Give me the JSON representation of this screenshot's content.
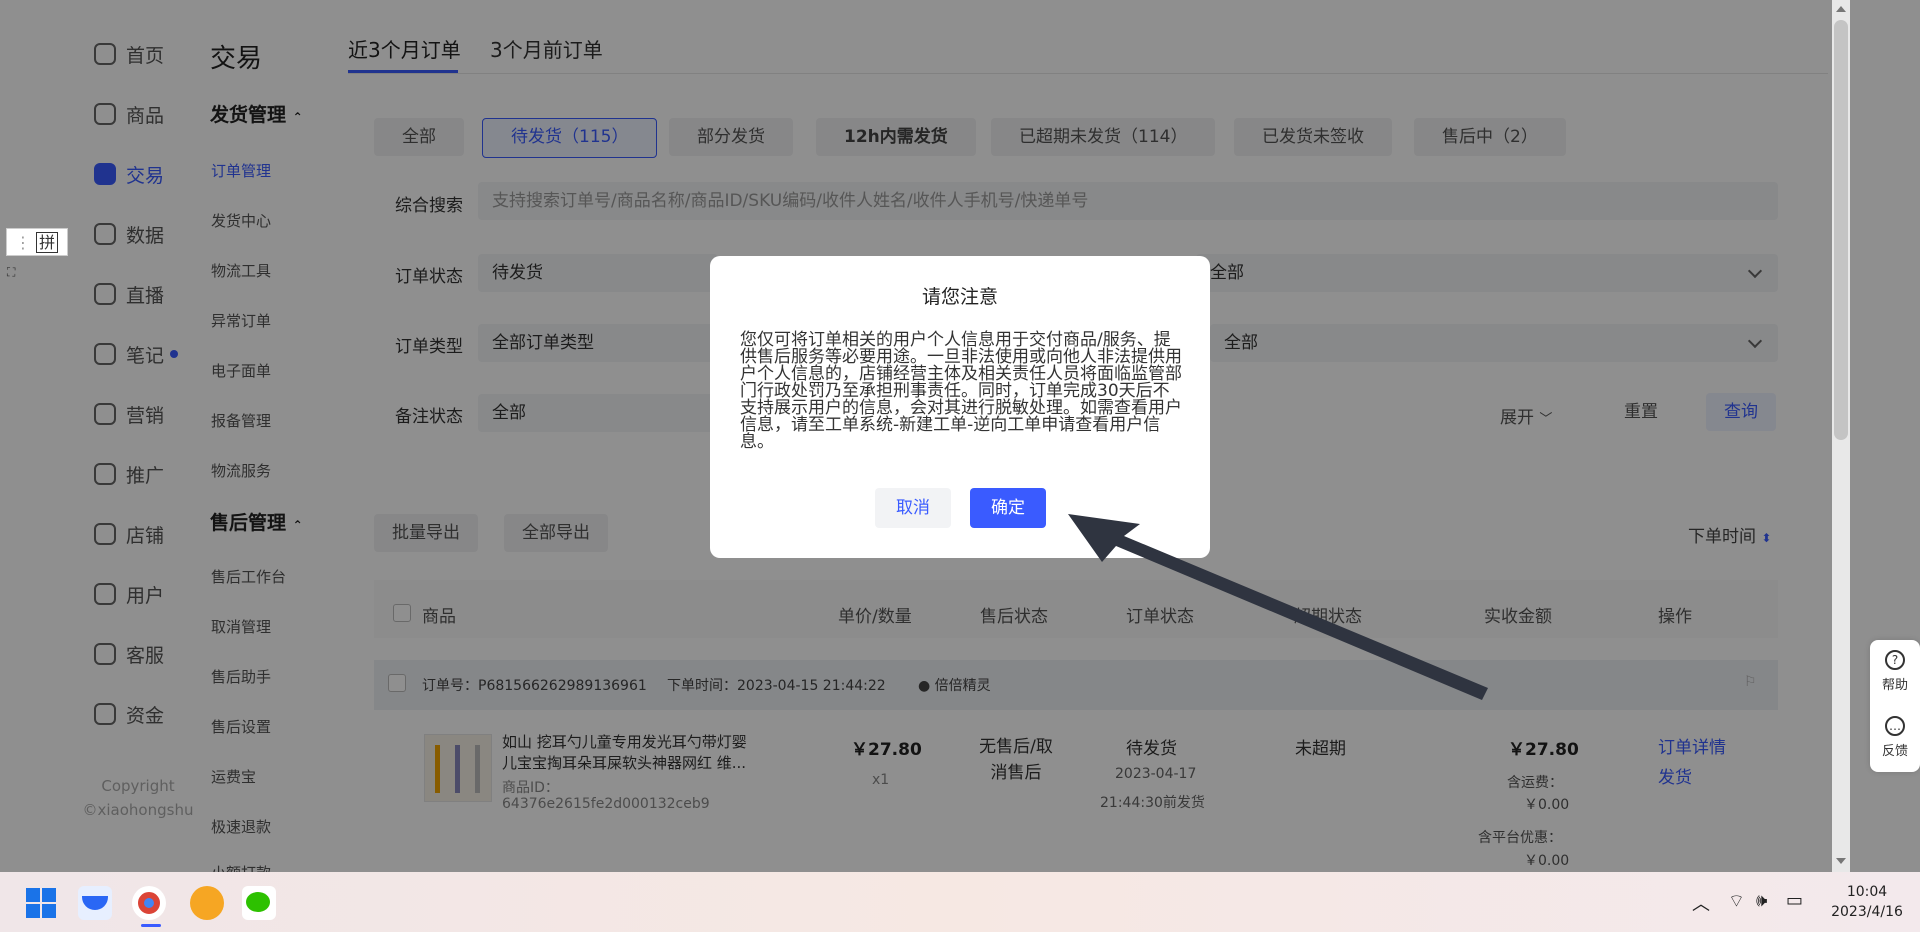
{
  "nav_primary": [
    {
      "label": "首页",
      "icon": "home-icon"
    },
    {
      "label": "商品",
      "icon": "product-icon"
    },
    {
      "label": "交易",
      "icon": "trade-icon"
    },
    {
      "label": "数据",
      "icon": "chart-icon"
    },
    {
      "label": "直播",
      "icon": "live-icon"
    },
    {
      "label": "笔记",
      "icon": "note-icon"
    },
    {
      "label": "营销",
      "icon": "megaphone-icon"
    },
    {
      "label": "推广",
      "icon": "promote-icon"
    },
    {
      "label": "店铺",
      "icon": "store-icon"
    },
    {
      "label": "用户",
      "icon": "users-icon"
    },
    {
      "label": "客服",
      "icon": "service-icon"
    },
    {
      "label": "资金",
      "icon": "wallet-icon"
    }
  ],
  "copyright": [
    "Copyright",
    "©xiaohongshu"
  ],
  "nav_secondary": {
    "title": "交易",
    "group1": "发货管理",
    "group1_items": [
      "订单管理",
      "发货中心",
      "物流工具",
      "异常订单",
      "电子面单",
      "报备管理",
      "物流服务"
    ],
    "group2": "售后管理",
    "group2_items": [
      "售后工作台",
      "取消管理",
      "售后助手",
      "售后设置",
      "运费宝",
      "极速退款",
      "小额打款"
    ]
  },
  "tabs": [
    "近3个月订单",
    "3个月前订单"
  ],
  "filter_pills": [
    "全部",
    "待发货（115）",
    "部分发货",
    "12h内需发货",
    "已超期未发货（114）",
    "已发货未签收",
    "售后中（2）"
  ],
  "search": {
    "label": "综合搜索",
    "placeholder": "支持搜索订单号/商品名称/商品ID/SKU编码/收件人姓名/收件人手机号/快递单号"
  },
  "filters": {
    "order_status_label": "订单状态",
    "order_status_value": "待发货",
    "order_status_right": "全部",
    "order_type_label": "订单类型",
    "order_type_value": "全部订单类型",
    "order_type_right": "全部",
    "remark_label": "备注状态",
    "remark_value": "全部",
    "expand": "展开",
    "reset": "重置",
    "query": "查询"
  },
  "actions": {
    "batch_export": "批量导出",
    "export_all": "全部导出",
    "sort": "下单时间"
  },
  "table_headers": [
    "商品",
    "单价/数量",
    "售后状态",
    "订单状态",
    "超期状态",
    "实收金额",
    "操作"
  ],
  "order": {
    "number": "订单号：P681566262989136961",
    "time": "下单时间：2023-04-15 21:44:22",
    "shop": "倍倍精灵",
    "product_title": "如山 挖耳勺儿童专用发光耳勺带灯婴儿宝宝掏耳朵耳屎软头神器网红 维...",
    "product_id_label": "商品ID：",
    "product_id": "64376e2615fe2d000132ceb9",
    "price": "￥27.80",
    "qty": "x1",
    "aftersale": "无售后/取消售后",
    "status": "待发货",
    "ship_by_date": "2023-04-17",
    "ship_by_time": "21:44:30前发货",
    "overdue": "未超期",
    "amount": "￥27.80",
    "freight_label": "含运费：",
    "freight": "￥0.00",
    "discount_label": "含平台优惠：",
    "discount": "￥0.00",
    "op_detail": "订单详情",
    "op_ship": "发货"
  },
  "help": {
    "help": "帮助",
    "feedback": "反馈"
  },
  "modal": {
    "title": "请您注意",
    "body": "您仅可将订单相关的用户个人信息用于交付商品/服务、提供售后服务等必要用途。一旦非法使用或向他人非法提供用户个人信息的，店铺经营主体及相关责任人员将面临监管部门行政处罚乃至承担刑事责任。同时，订单完成30天后不支持展示用户的信息，会对其进行脱敏处理。如需查看用户信息，请至工单系统-新建工单-逆向工单申请查看用户信息。",
    "cancel": "取消",
    "confirm": "确定"
  },
  "ime": "拼",
  "taskbar": {
    "time": "10:04",
    "date": "2023/4/16"
  },
  "colors": {
    "accent": "#3a5bff",
    "overlay": "rgba(0,0,0,0.44)"
  }
}
